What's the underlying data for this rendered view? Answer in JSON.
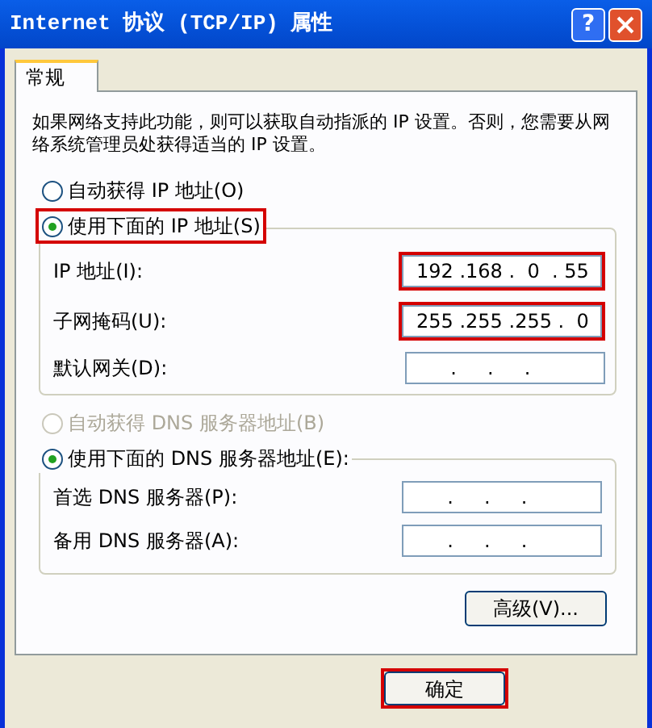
{
  "window": {
    "title": "Internet 协议 (TCP/IP) 属性"
  },
  "title_buttons": [
    {
      "kind": "help",
      "label": "?"
    },
    {
      "kind": "close"
    }
  ],
  "tabs": [
    {
      "label": "常规",
      "selected": true
    }
  ],
  "description": "如果网络支持此功能，则可以获取自动指派的 IP 设置。否则，您需要从网络系统管理员处获得适当的 IP 设置。",
  "ip_mode": [
    {
      "label": "自动获得 IP 地址(O)",
      "selected": false,
      "disabled": false,
      "highlighted": false
    },
    {
      "label": "使用下面的 IP 地址(S)",
      "selected": true,
      "disabled": false,
      "highlighted": true
    }
  ],
  "ip_fields": [
    {
      "label": "IP 地址(I):",
      "value": "192 .168 .  0  . 55",
      "highlighted": true
    },
    {
      "label": "子网掩码(U):",
      "value": "255 .255 .255 .  0",
      "highlighted": true
    },
    {
      "label": "默认网关(D):",
      "value": "     .     .     .",
      "highlighted": false
    }
  ],
  "dns_mode": [
    {
      "label": "自动获得 DNS 服务器地址(B)",
      "selected": false,
      "disabled": true,
      "highlighted": false
    },
    {
      "label": "使用下面的 DNS 服务器地址(E):",
      "selected": true,
      "disabled": false,
      "highlighted": false
    }
  ],
  "dns_fields": [
    {
      "label": "首选 DNS 服务器(P):",
      "value": "     .     .     .",
      "highlighted": false
    },
    {
      "label": "备用 DNS 服务器(A):",
      "value": "     .     .     .",
      "highlighted": false
    }
  ],
  "advanced_button": "高级(V)...",
  "ok_button": {
    "label": "确定",
    "highlighted": true
  }
}
